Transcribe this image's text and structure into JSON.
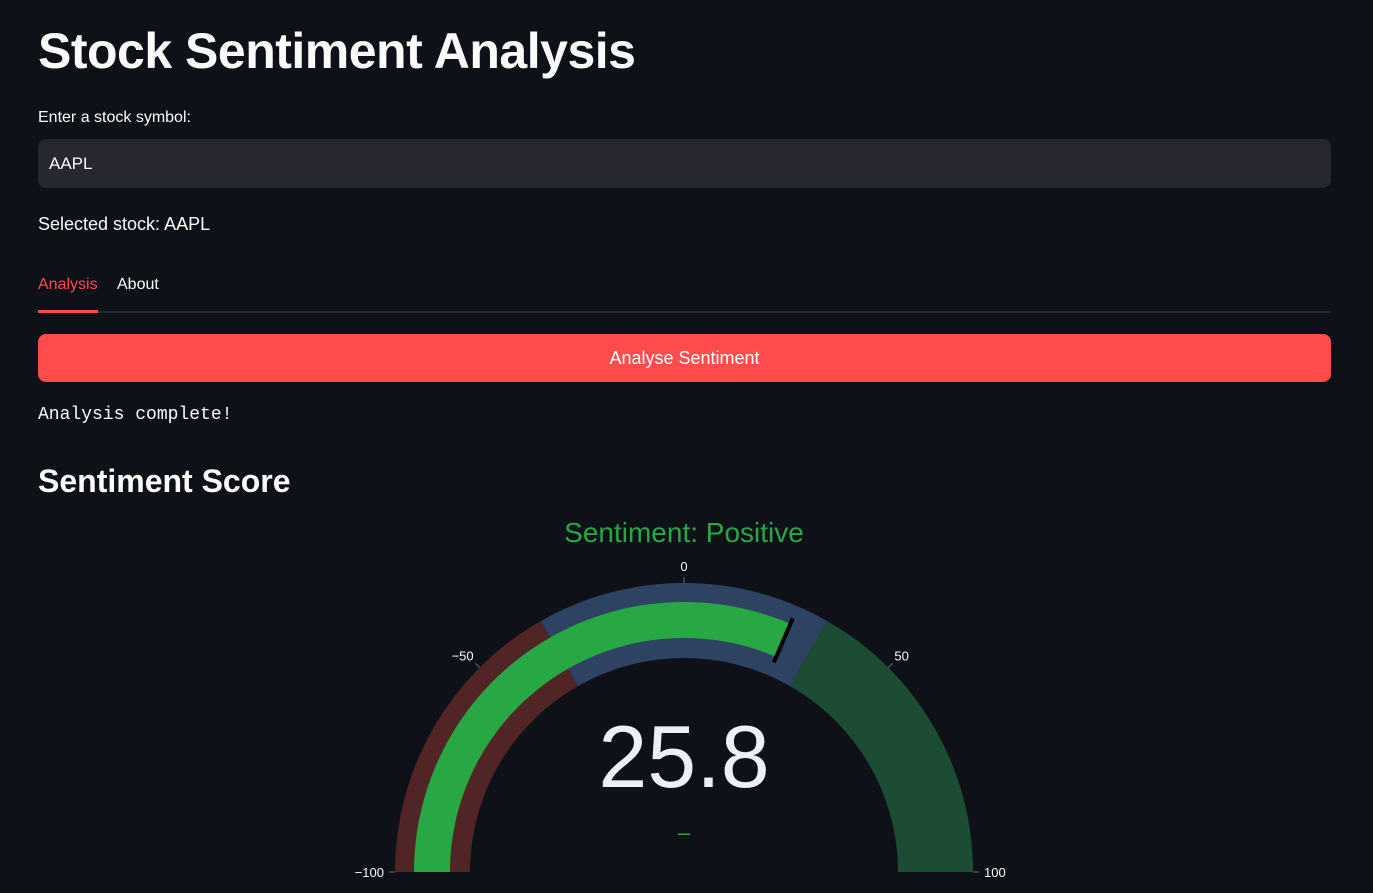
{
  "header": {
    "title": "Stock Sentiment Analysis"
  },
  "symbol_input": {
    "label": "Enter a stock symbol:",
    "value": "AAPL"
  },
  "selection": {
    "text": "Selected stock: AAPL"
  },
  "tabs": [
    {
      "label": "Analysis",
      "active": true
    },
    {
      "label": "About",
      "active": false
    }
  ],
  "actions": {
    "analyse_label": "Analyse Sentiment"
  },
  "status": {
    "text": "Analysis complete!"
  },
  "section": {
    "title": "Sentiment Score"
  },
  "chart_data": {
    "type": "gauge",
    "title": "Sentiment: Positive",
    "value": 25.8,
    "value_label": "25.8",
    "delta_marker": "–",
    "range": [
      -100,
      100
    ],
    "ticks": [
      -100,
      -50,
      0,
      50,
      100
    ],
    "tick_labels": [
      "−100",
      "−50",
      "0",
      "50",
      "100"
    ],
    "steps": [
      {
        "range": [
          -100,
          -33
        ],
        "color": "#512525"
      },
      {
        "range": [
          -33,
          33
        ],
        "color": "#2e4361"
      },
      {
        "range": [
          33,
          100
        ],
        "color": "#1c4c33"
      }
    ],
    "bar_color": "#28a745",
    "threshold": 25.8,
    "threshold_color": "#000000",
    "title_color": "#28a745"
  }
}
